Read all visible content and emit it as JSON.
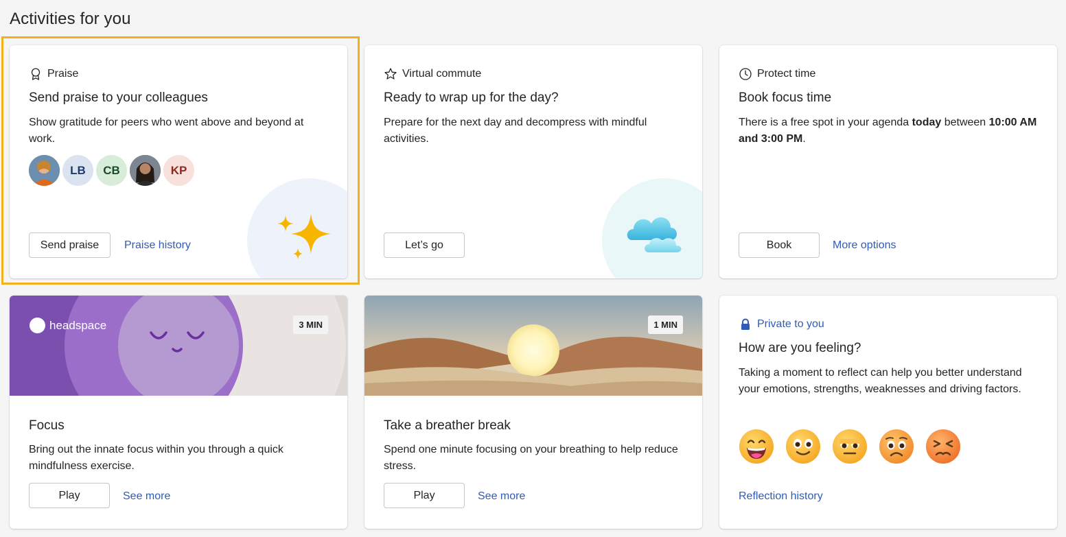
{
  "page": {
    "title": "Activities for you"
  },
  "praise": {
    "eyebrow": "Praise",
    "title": "Send praise to your colleagues",
    "description": "Show gratitude for peers who went above and beyond at work.",
    "avatars": [
      "",
      "LB",
      "CB",
      "",
      "KP"
    ],
    "primary_button": "Send praise",
    "link": "Praise history"
  },
  "commute": {
    "eyebrow": "Virtual commute",
    "title": "Ready to wrap up for the day?",
    "description": "Prepare for the next day and decompress with mindful activities.",
    "primary_button": "Let’s go"
  },
  "protect": {
    "eyebrow": "Protect time",
    "title": "Book focus time",
    "desc_prefix": "There is a free spot in your agenda ",
    "desc_bold1": "today",
    "desc_mid": " between ",
    "desc_bold2": "10:00 AM and 3:00 PM",
    "desc_suffix": ".",
    "primary_button": "Book",
    "link": "More options"
  },
  "focus": {
    "brand": "headspace",
    "badge": "3 MIN",
    "title": "Focus",
    "description": "Bring out the innate focus within you through a quick mindfulness exercise.",
    "primary_button": "Play",
    "link": "See more"
  },
  "breather": {
    "badge": "1 MIN",
    "title": "Take a breather break",
    "description": "Spend one minute focusing on your breathing to help reduce stress.",
    "primary_button": "Play",
    "link": "See more"
  },
  "feeling": {
    "eyebrow": "Private to you",
    "title": "How are you feeling?",
    "description": "Taking a moment to reflect can help you better understand your emotions, strengths, weaknesses and driving factors.",
    "emojis": [
      "very-happy",
      "happy",
      "neutral",
      "worried",
      "upset"
    ],
    "link": "Reflection history"
  },
  "colors": {
    "accent_link": "#2f5cb8",
    "focus_outline": "#f2b01e",
    "lock_blue": "#2f5cb8"
  }
}
